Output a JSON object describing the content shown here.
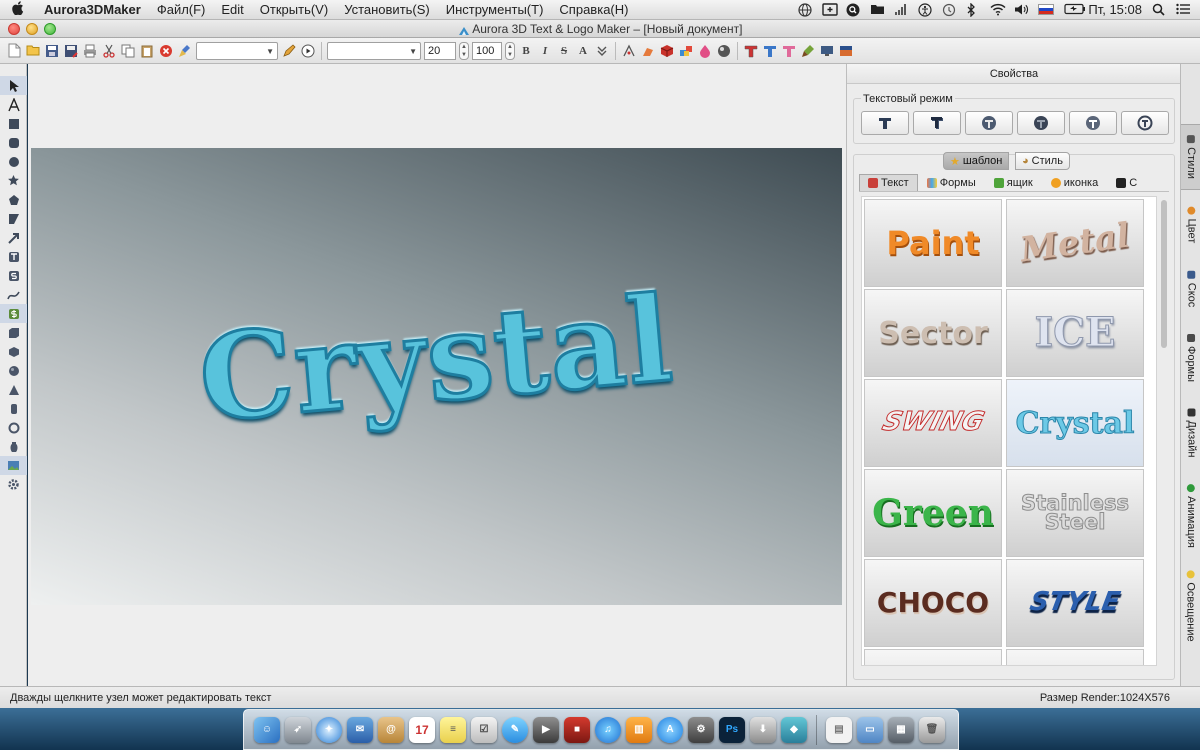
{
  "menubar": {
    "app_name": "Aurora3DMaker",
    "menus": [
      "Файл(F)",
      "Edit",
      "Открыть(V)",
      "Установить(S)",
      "Инструменты(T)",
      "Справка(H)"
    ],
    "clock": "Пт, 15:08"
  },
  "window": {
    "title": "Aurora 3D Text & Logo Maker – [Новый документ]"
  },
  "toolbar": {
    "font_size": "20",
    "zoom": "100",
    "font_name": "",
    "preset_name": "",
    "bold_label": "B",
    "italic_label": "I",
    "strike_label": "S",
    "caps_label": "A"
  },
  "canvas": {
    "text": "Crystal",
    "text_color": "#58c3dc"
  },
  "panel": {
    "title": "Свойства",
    "mode_group_label": "Текстовый режим",
    "segments": {
      "template": "шаблон",
      "style": "Стиль"
    },
    "categories": [
      "Текст",
      "Формы",
      "ящик",
      "иконка",
      "С"
    ],
    "thumbnails": [
      "Paint",
      "Metal",
      "Sector",
      "ICE",
      "SWING",
      "Crystal",
      "Green",
      "Stainless Steel",
      "CHOCO",
      "STYLE"
    ],
    "side_tabs": [
      "Стили",
      "Цвет",
      "Скос",
      "Формы",
      "Дизайн",
      "Анимация",
      "Освещение"
    ]
  },
  "statusbar": {
    "hint": "Дважды щелкните узел может редактировать текст",
    "render_size": "Размер Render:1024X576"
  },
  "dock": {
    "calendar_day": "17",
    "ps_label": "Ps"
  }
}
